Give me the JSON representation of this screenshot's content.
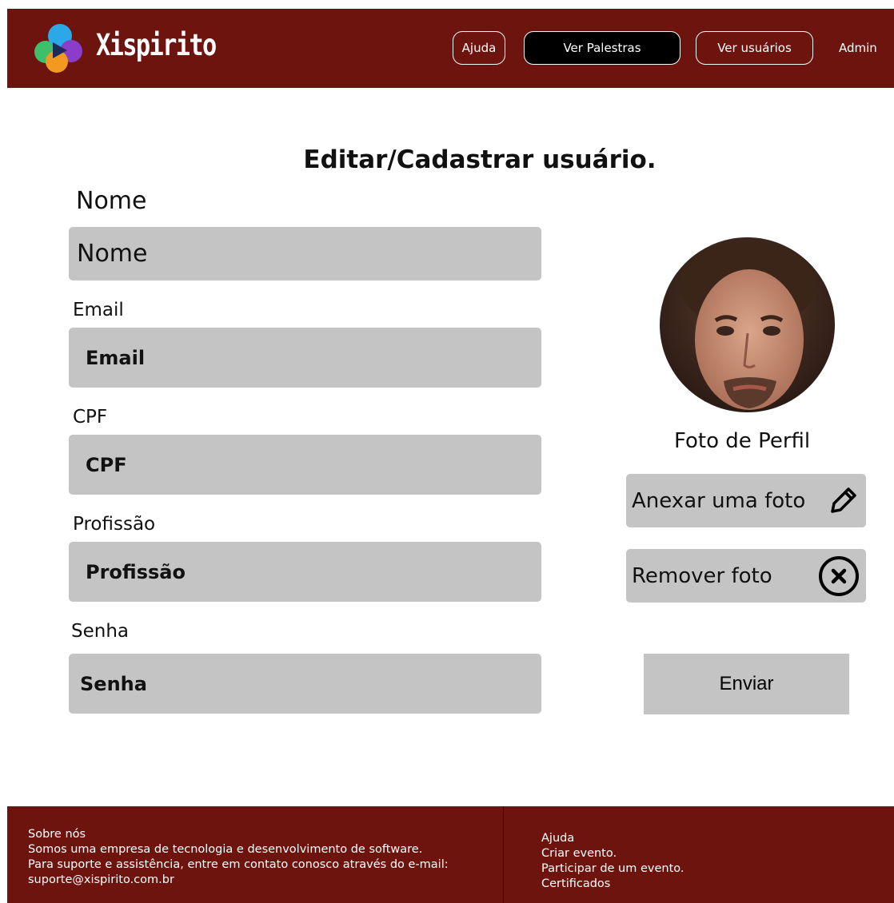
{
  "header": {
    "brand": "Xispirito",
    "nav": {
      "help": "Ajuda",
      "talks": "Ver Palestras",
      "users": "Ver usuários",
      "admin": "Admin"
    }
  },
  "form": {
    "title": "Editar/Cadastrar usuário.",
    "name": {
      "label": "Nome",
      "placeholder": "Nome"
    },
    "email": {
      "label": "Email",
      "placeholder": "Email"
    },
    "cpf": {
      "label": "CPF",
      "placeholder": "CPF"
    },
    "profession": {
      "label": "Profissão",
      "placeholder": "Profissão"
    },
    "password": {
      "label": "Senha",
      "placeholder": "Senha"
    }
  },
  "profile": {
    "photo_label": "Foto de Perfil",
    "attach_label": "Anexar uma foto",
    "remove_label": "Remover foto",
    "submit_label": "Enviar"
  },
  "footer": {
    "about_title": "Sobre nós",
    "about_line1": "Somos uma empresa de tecnologia e desenvolvimento de software.",
    "about_line2": "Para suporte e assistência, entre em contato conosco através do e-mail:",
    "about_email": "suporte@xispirito.com.br",
    "links": [
      "Ajuda",
      "Criar evento.",
      "Participar de um evento.",
      "Certificados"
    ]
  },
  "colors": {
    "brand": "#6e140f",
    "field": "#c4c4c4",
    "active_nav": "#000000"
  }
}
